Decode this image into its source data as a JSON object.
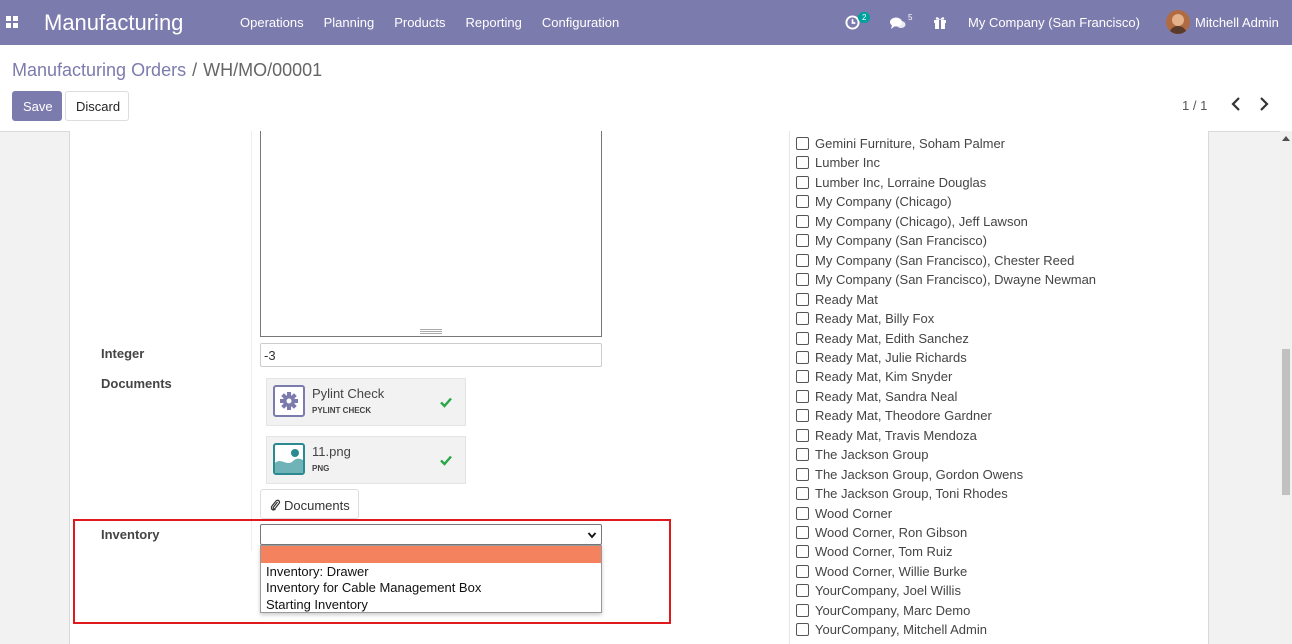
{
  "navbar": {
    "app_title": "Manufacturing",
    "menu": [
      "Operations",
      "Planning",
      "Products",
      "Reporting",
      "Configuration"
    ],
    "activity_count": "2",
    "messages_count": "5",
    "company": "My Company (San Francisco)",
    "user": "Mitchell Admin",
    "icons": [
      "apps-grid-icon",
      "activity-clock-icon",
      "chat-bubbles-icon",
      "gift-icon"
    ]
  },
  "breadcrumb": {
    "parent": "Manufacturing Orders",
    "separator": "/",
    "current": "WH/MO/00001"
  },
  "buttons": {
    "save": "Save",
    "discard": "Discard",
    "documents": "Documents"
  },
  "pager": {
    "value": "1 / 1"
  },
  "form": {
    "integer_label": "Integer",
    "integer_value": "-3",
    "documents_label": "Documents",
    "documents": [
      {
        "name": "Pylint Check",
        "type": "PYLINT CHECK",
        "icon": "gear-icon"
      },
      {
        "name": "11.png",
        "type": "PNG",
        "icon": "image-icon"
      }
    ],
    "inventory_label": "Inventory",
    "inventory_value": "",
    "inventory_options": [
      "",
      "Inventory: Drawer",
      "Inventory for Cable Management Box",
      "Starting Inventory"
    ]
  },
  "partners": [
    "Gemini Furniture, Soham Palmer",
    "Lumber Inc",
    "Lumber Inc, Lorraine Douglas",
    "My Company (Chicago)",
    "My Company (Chicago), Jeff Lawson",
    "My Company (San Francisco)",
    "My Company (San Francisco), Chester Reed",
    "My Company (San Francisco), Dwayne Newman",
    "Ready Mat",
    "Ready Mat, Billy Fox",
    "Ready Mat, Edith Sanchez",
    "Ready Mat, Julie Richards",
    "Ready Mat, Kim Snyder",
    "Ready Mat, Sandra Neal",
    "Ready Mat, Theodore Gardner",
    "Ready Mat, Travis Mendoza",
    "The Jackson Group",
    "The Jackson Group, Gordon Owens",
    "The Jackson Group, Toni Rhodes",
    "Wood Corner",
    "Wood Corner, Ron Gibson",
    "Wood Corner, Tom Ruiz",
    "Wood Corner, Willie Burke",
    "YourCompany, Joel Willis",
    "YourCompany, Marc Demo",
    "YourCompany, Mitchell Admin"
  ],
  "colors": {
    "brand": "#7c7bad",
    "highlight_border": "#e0191c",
    "selected_option": "#f4825f",
    "check": "#28a745"
  }
}
